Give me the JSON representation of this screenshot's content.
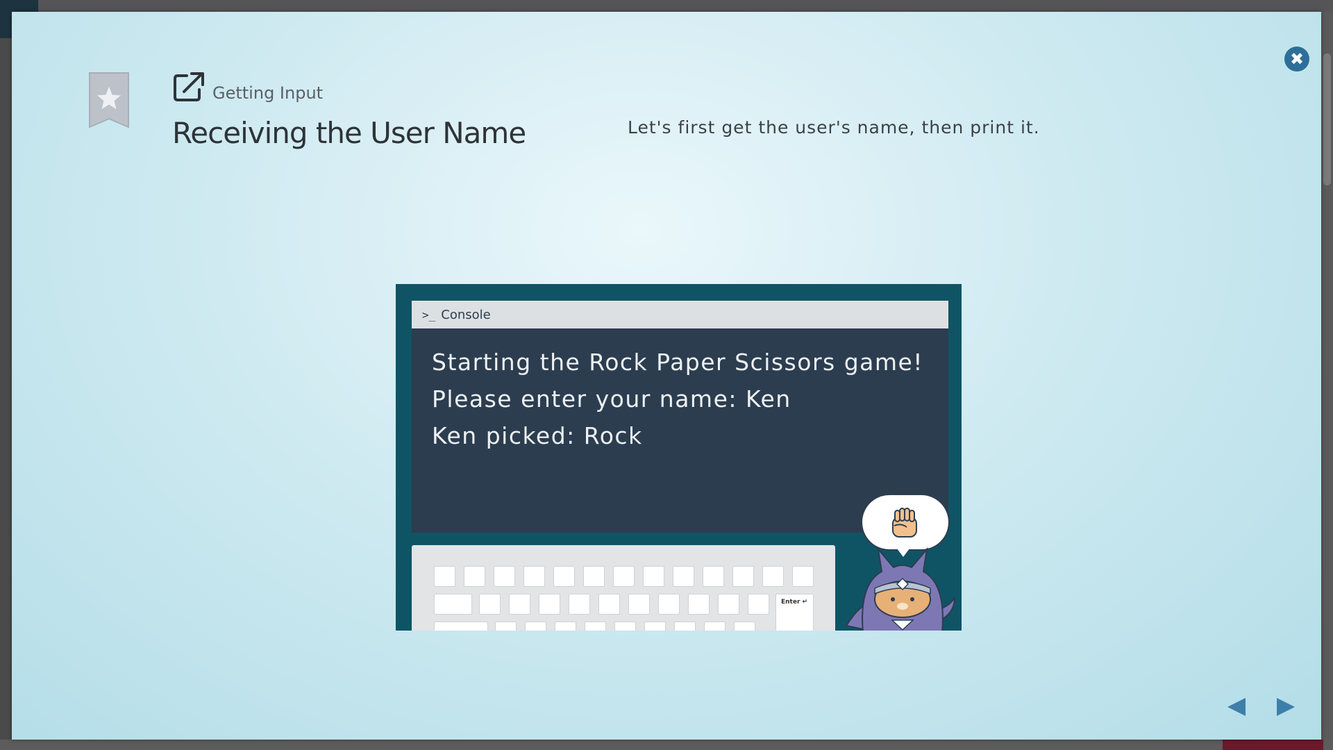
{
  "modal": {
    "section_label": "Getting Input",
    "title": "Receiving the User Name",
    "description": "Let's first get the user's name, then print it."
  },
  "icons": {
    "close": "close-icon",
    "bookmark": "bookmark-star-icon",
    "link": "external-link-icon",
    "prev": "triangle-left-icon",
    "next": "triangle-right-icon"
  },
  "slide": {
    "console_title": "Console",
    "console_lines": [
      "Starting the Rock Paper Scissors game!",
      "Please enter your name: Ken",
      "Ken picked: Rock"
    ],
    "enter_key_label": "Enter ↵",
    "speech_bubble_icon": "rock-fist-icon"
  },
  "colors": {
    "accent": "#2d6f98",
    "console_bg": "#2c3d50",
    "slide_bg": "#0f5465",
    "mascot": "#7d78b4"
  }
}
